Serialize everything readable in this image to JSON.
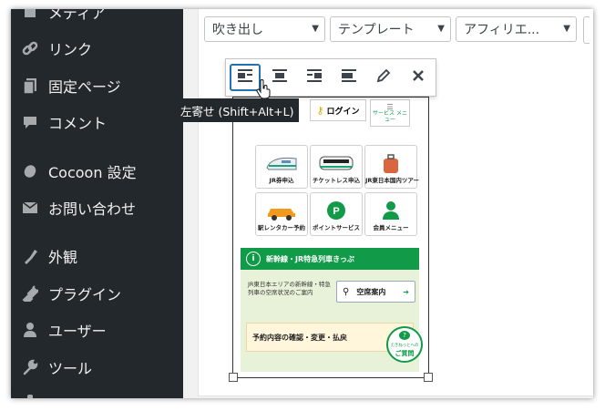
{
  "sidebar": {
    "items": [
      {
        "label": "メディア",
        "icon": "media-icon"
      },
      {
        "label": "リンク",
        "icon": "link-icon"
      },
      {
        "label": "固定ページ",
        "icon": "page-icon"
      },
      {
        "label": "コメント",
        "icon": "comment-icon"
      },
      {
        "label": "Cocoon 設定",
        "icon": "cocoon-icon"
      },
      {
        "label": "お問い合わせ",
        "icon": "mail-icon"
      },
      {
        "label": "外観",
        "icon": "appearance-icon"
      },
      {
        "label": "プラグイン",
        "icon": "plugin-icon"
      },
      {
        "label": "ユーザー",
        "icon": "user-icon"
      },
      {
        "label": "ツール",
        "icon": "wrench-icon"
      }
    ]
  },
  "editor": {
    "selects": [
      {
        "value": "吹き出し"
      },
      {
        "value": "テンプレート"
      },
      {
        "value": "アフィリエ..."
      }
    ]
  },
  "toolbar": {
    "buttons": [
      "align-left-icon",
      "align-center-icon",
      "align-right-icon",
      "align-none-icon",
      "edit-icon",
      "remove-icon"
    ],
    "tooltip": "左寄せ (Shift+Alt+L)"
  },
  "image": {
    "login_label": "ログイン",
    "service_label": "サービス メニュー",
    "tiles": [
      {
        "label": "JR券申込"
      },
      {
        "label": "チケットレス申込"
      },
      {
        "label": "JR東日本国内ツアー"
      },
      {
        "label": "駅レンタカー予約"
      },
      {
        "label": "ポイントサービス"
      },
      {
        "label": "会員メニュー"
      }
    ],
    "banner": "新幹線・JR特急列車きっぷ",
    "info_text": "JR東日本エリアの新幹線・特急列車の空席状況のご案内",
    "seat_button": "空席案内",
    "reservation": "予約内容の確認・変更・払戻",
    "help_top": "えきねっとへの",
    "help_bottom": "ご質問"
  },
  "colors": {
    "sidebar_bg": "#23282d",
    "accent": "#2271b1",
    "ekinet_green": "#119a48"
  }
}
